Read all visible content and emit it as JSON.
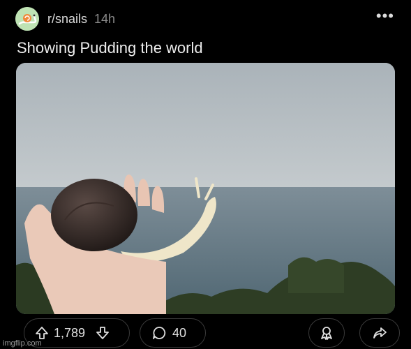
{
  "post": {
    "subreddit": "r/snails",
    "time_ago": "14h",
    "title": "Showing Pudding the world"
  },
  "actions": {
    "score": "1,789",
    "comments": "40"
  },
  "watermark": "imgflip.com",
  "colors": {
    "background": "#000000",
    "pill_border": "#3a3a3a",
    "text": "#e8e8e8",
    "muted_text": "#8a8a8a"
  },
  "icons": {
    "more": "ellipsis-icon",
    "upvote": "arrow-up-icon",
    "downvote": "arrow-down-icon",
    "comment": "speech-bubble-icon",
    "award": "award-icon",
    "share": "share-arrow-icon"
  }
}
